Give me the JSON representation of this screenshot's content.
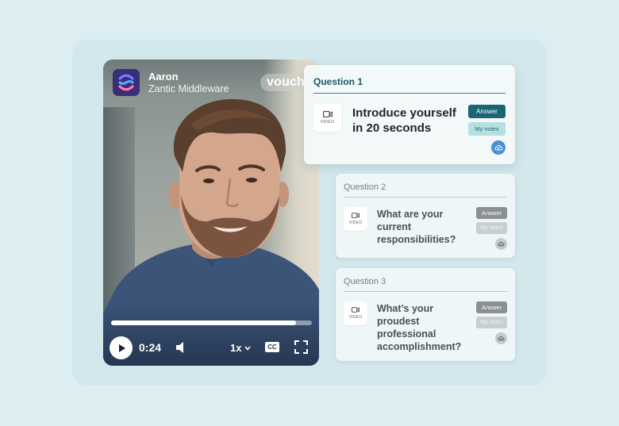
{
  "video": {
    "candidate_name": "Aaron",
    "company": "Zantic Middleware",
    "watermark": "vouch",
    "time": "0:24",
    "progress": 0.92,
    "speed": "1x",
    "cc_label": "CC"
  },
  "questions": [
    {
      "title": "Question 1",
      "text": "Introduce yourself in 20 seconds",
      "media_label": "VIDEO",
      "answer_label": "Answer",
      "notes_label": "My notes",
      "active": true
    },
    {
      "title": "Question 2",
      "text": "What are your current responsibilities?",
      "media_label": "VIDEO",
      "answer_label": "Answer",
      "notes_label": "My notes",
      "active": false
    },
    {
      "title": "Question 3",
      "text": "What’s your proudest professional accomplishment?",
      "media_label": "VIDEO",
      "answer_label": "Answer",
      "notes_label": "My notes",
      "active": false
    }
  ],
  "colors": {
    "background": "#dceef2",
    "accent": "#1a6673",
    "upload_active": "#4a90d9"
  }
}
